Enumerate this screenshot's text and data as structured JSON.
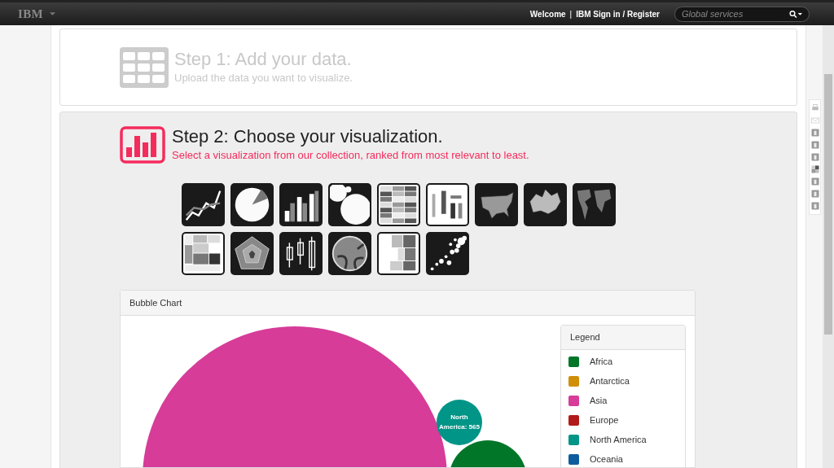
{
  "topbar": {
    "logo": "IBM",
    "welcome": "Welcome",
    "separator": "|",
    "signin": "IBM Sign in / Register",
    "search": {
      "placeholder": "Global services"
    }
  },
  "step1": {
    "title": "Step 1: Add your data.",
    "subtitle": "Upload the data you want to visualize."
  },
  "step2": {
    "title": "Step 2: Choose your visualization.",
    "subtitle": "Select a visualization from our collection, ranked from most relevant to least."
  },
  "thumbnails": [
    {
      "kind": "line"
    },
    {
      "kind": "pie"
    },
    {
      "kind": "bar"
    },
    {
      "kind": "bubble"
    },
    {
      "kind": "heatmap"
    },
    {
      "kind": "wordcloud"
    },
    {
      "kind": "usmap"
    },
    {
      "kind": "canadamap"
    },
    {
      "kind": "worldmap"
    },
    {
      "kind": "treemap"
    },
    {
      "kind": "radar"
    },
    {
      "kind": "boxplot"
    },
    {
      "kind": "chord"
    },
    {
      "kind": "blocks"
    },
    {
      "kind": "scatter"
    }
  ],
  "panel": {
    "title": "Bubble Chart",
    "bubble_label": [
      "North",
      "America: 565"
    ],
    "legend": {
      "title": "Legend",
      "items": [
        {
          "name": "Africa",
          "color": "#017629"
        },
        {
          "name": "Antarctica",
          "color": "#d08f09"
        },
        {
          "name": "Asia",
          "color": "#d63c98"
        },
        {
          "name": "Europe",
          "color": "#b01b19"
        },
        {
          "name": "North America",
          "color": "#009587"
        },
        {
          "name": "Oceania",
          "color": "#0e5c9e"
        }
      ]
    }
  },
  "share": [
    {
      "kind": "print"
    },
    {
      "kind": "mail"
    },
    {
      "kind": "digg"
    },
    {
      "kind": "facebook"
    },
    {
      "kind": "twitter"
    },
    {
      "kind": "delicious"
    },
    {
      "kind": "linkedin"
    },
    {
      "kind": "stumble"
    },
    {
      "kind": "google"
    }
  ]
}
